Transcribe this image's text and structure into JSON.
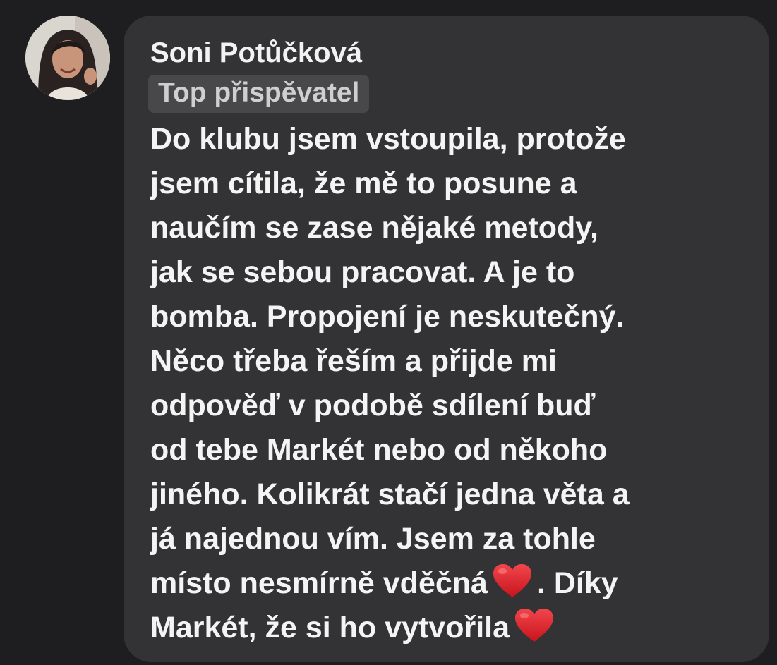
{
  "comment": {
    "author_name": "Soni Potůčková",
    "badge": "Top přispěvatel",
    "avatar_icon": "profile-photo",
    "text_lines": [
      "Do klubu jsem vstoupila, protože",
      "jsem cítila, že mě to posune a",
      "naučím se zase nějaké metody,",
      "jak se sebou pracovat. A je to",
      "bomba. Propojení je neskutečný.",
      "Něco třeba řeším a přijde mi",
      "odpověď v podobě sdílení buď",
      "od tebe Markét nebo od někoho",
      "jiného. Kolikrát stačí jedna věta a",
      "já najednou vím. Jsem za tohle"
    ],
    "line_11_start": "místo nesmírně vděčná",
    "line_11_end": ". Díky",
    "line_12": "Markét, že si ho vytvořila",
    "emoji": "heart-emoji",
    "colors": {
      "background": "#1e1e20",
      "bubble": "#333336",
      "badge_bg": "#48484b",
      "text": "#f4f4f4",
      "heart": "#e0262c"
    }
  }
}
